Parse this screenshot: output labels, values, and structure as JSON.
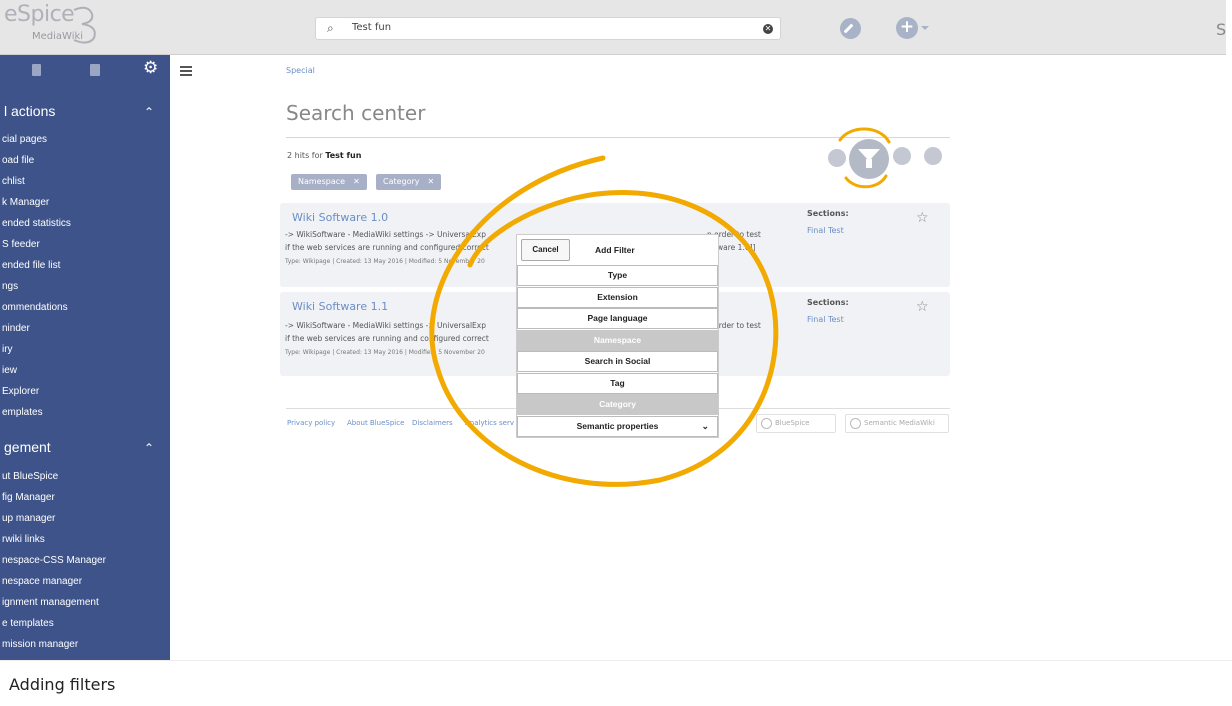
{
  "logo": {
    "main": "eSpice",
    "sub": "MediaWiki"
  },
  "search": {
    "query": "Test fun"
  },
  "top_right_letter": "S",
  "sidebar": {
    "section1": "l actions",
    "items1": [
      "cial pages",
      "oad file",
      "chlist",
      "k Manager",
      "ended statistics",
      "S feeder",
      "ended file list",
      "ngs",
      "ommendations",
      "ninder",
      "iry",
      "iew",
      "Explorer",
      "emplates"
    ],
    "section2": "gement",
    "items2": [
      "ut BlueSpice",
      "fig Manager",
      "up manager",
      "rwiki links",
      "nespace-CSS Manager",
      "nespace manager",
      "ignment management",
      "e templates",
      "mission manager"
    ]
  },
  "breadcrumb": "Special",
  "page_title": "Search center",
  "hits": {
    "prefix": "2 hits for",
    "term": "Test fun"
  },
  "chips": [
    "Namespace",
    "Category"
  ],
  "results": [
    {
      "title": "Wiki Software 1.0",
      "line1": "-> WikiSoftware - MediaWiki settings -> UniversalExp",
      "line2": "if the web services are running and configured correct",
      "meta": "Type: Wikipage | Created: 13 May 2016 | Modified: 5 November 20",
      "right1": "n order to test",
      "right2": "oftware 1.0]]",
      "sections_label": "Sections:",
      "sections_link": "Final Test"
    },
    {
      "title": "Wiki Software 1.1",
      "line1": "-> WikiSoftware - MediaWiki settings -> UniversalExp",
      "line2": "if the web services are running and configured correct",
      "meta": "Type: Wikipage | Created: 13 May 2016 | Modified: 5 November 20",
      "right1": "n order to test",
      "right2": "",
      "sections_label": "Sections:",
      "sections_link": "Final Test"
    }
  ],
  "footer": {
    "links": [
      "Privacy policy",
      "About BlueSpice",
      "Disclaimers",
      "Analytics serv"
    ],
    "badge1": "BlueSpice",
    "badge2": "Semantic MediaWiki"
  },
  "filter_menu": {
    "cancel": "Cancel",
    "title": "Add Filter",
    "items": [
      {
        "label": "Type",
        "disabled": false
      },
      {
        "label": "Extension",
        "disabled": false
      },
      {
        "label": "Page language",
        "disabled": false
      },
      {
        "label": "Namespace",
        "disabled": true
      },
      {
        "label": "Search in Social",
        "disabled": false
      },
      {
        "label": "Tag",
        "disabled": false
      },
      {
        "label": "Category",
        "disabled": true
      },
      {
        "label": "Semantic properties",
        "disabled": false
      }
    ]
  },
  "caption": "Adding filters",
  "colors": {
    "sidebar": "#3e5389",
    "annotation": "#f2a900",
    "link": "#6a8ec7"
  }
}
